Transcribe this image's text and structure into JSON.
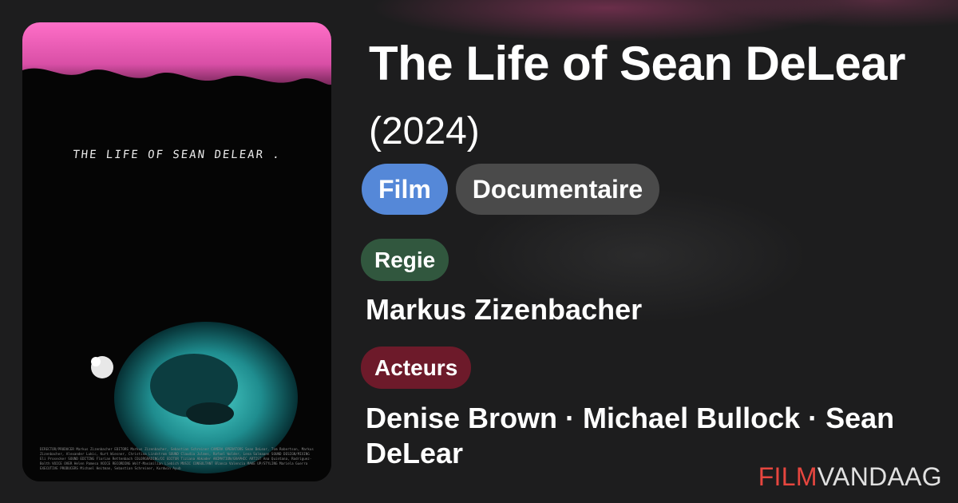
{
  "poster": {
    "title": "THE LIFE OF SEAN DELEAR .",
    "credits": "DIRECTOR/PRODUCER Markus Zizenbacher EDITORS Markus Zizenbacher, Sebastian Schreiner CAMERA OPERATORS Sean DeLear, Tom Robertson, Markus Zizenbacher, Alexander Lukic, Kurt Wiesner, Christina Lindstrom SOUND Claudia Julmes, Rafael Wolder, Lena Salmaann SOUND DESIGN/MIXING Eli Prosecker SOUND EDITING Florian Rettenbach COLORGRADING/DI EDITOR Tiziana Abkader ANIMATION/GRAPHIC ARTIST Ana Quintana, Rodriguez-Bolth VOICE OVER Helen Pamesa VOICE RECORDING Wolf-Maximilian Liebich MUSIC CONSULTANT Blanca Valencia MAKE UP/STYLING Mariela Guerra EXECUTIVE PRODUCERS Michael Heitman, Sebastian Schreiner, Kurdwin Ayub"
  },
  "movie": {
    "title": "The Life of Sean DeLear",
    "year": "(2024)"
  },
  "tags": {
    "type": "Film",
    "genre": "Documentaire"
  },
  "director": {
    "label": "Regie",
    "name": "Markus Zizenbacher"
  },
  "actors": {
    "label": "Acteurs",
    "names": "Denise Brown · Michael Bullock · Sean DeLear"
  },
  "brand": {
    "part1": "FILM",
    "part2": "VANDAAG"
  },
  "colors": {
    "film_tag": "#5588d8",
    "genre_tag": "#4a4a4a",
    "regie_badge": "#31573e",
    "acteurs_badge": "#6d1a2a",
    "brand_accent": "#e6463f",
    "background": "#1d1d1e"
  }
}
